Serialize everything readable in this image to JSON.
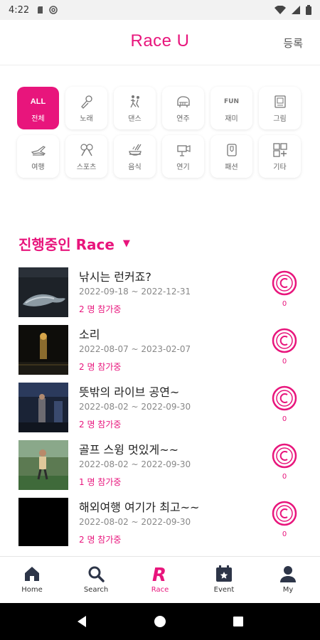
{
  "status_bar": {
    "time": "4:22"
  },
  "header": {
    "title": "Race U",
    "register": "등록"
  },
  "categories": [
    {
      "label": "전체",
      "top": "ALL",
      "icon": "all-icon",
      "active": true
    },
    {
      "label": "노래",
      "icon": "microphone-icon"
    },
    {
      "label": "댄스",
      "icon": "dance-icon"
    },
    {
      "label": "연주",
      "icon": "piano-icon"
    },
    {
      "label": "재미",
      "top": "FUN",
      "icon": "fun-icon"
    },
    {
      "label": "그림",
      "icon": "drawing-icon"
    },
    {
      "label": "여행",
      "icon": "travel-icon"
    },
    {
      "label": "스포츠",
      "icon": "sports-icon"
    },
    {
      "label": "음식",
      "icon": "food-icon"
    },
    {
      "label": "연기",
      "icon": "camera-icon"
    },
    {
      "label": "패션",
      "icon": "fashion-icon"
    },
    {
      "label": "기타",
      "icon": "etc-icon"
    }
  ],
  "section": {
    "title": "진행중인 Race"
  },
  "races": [
    {
      "title": "낚시는 런커죠?",
      "date": "2022-09-18 ~ 2022-12-31",
      "count": "2 명 참가중",
      "coin": "0"
    },
    {
      "title": "소리",
      "date": "2022-08-07 ~ 2023-02-07",
      "count": "2 명 참가중",
      "coin": "0"
    },
    {
      "title": "뜻밖의 라이브 공연~",
      "date": "2022-08-02 ~ 2022-09-30",
      "count": "2 명 참가중",
      "coin": "0"
    },
    {
      "title": "골프 스윙 멋있게~~",
      "date": "2022-08-02 ~ 2022-09-30",
      "count": "1 명 참가중",
      "coin": "0"
    },
    {
      "title": "해외여행 여기가 최고~~",
      "date": "2022-08-02 ~ 2022-09-30",
      "count": "2 명 참가중",
      "coin": "0"
    }
  ],
  "bottom_nav": [
    {
      "label": "Home",
      "icon": "home-icon"
    },
    {
      "label": "Search",
      "icon": "search-icon"
    },
    {
      "label": "Race",
      "icon": "race-r-icon",
      "active": true
    },
    {
      "label": "Event",
      "icon": "event-calendar-icon"
    },
    {
      "label": "My",
      "icon": "person-icon"
    }
  ],
  "colors": {
    "accent": "#e8157c",
    "text": "#222222",
    "muted": "#888888"
  }
}
